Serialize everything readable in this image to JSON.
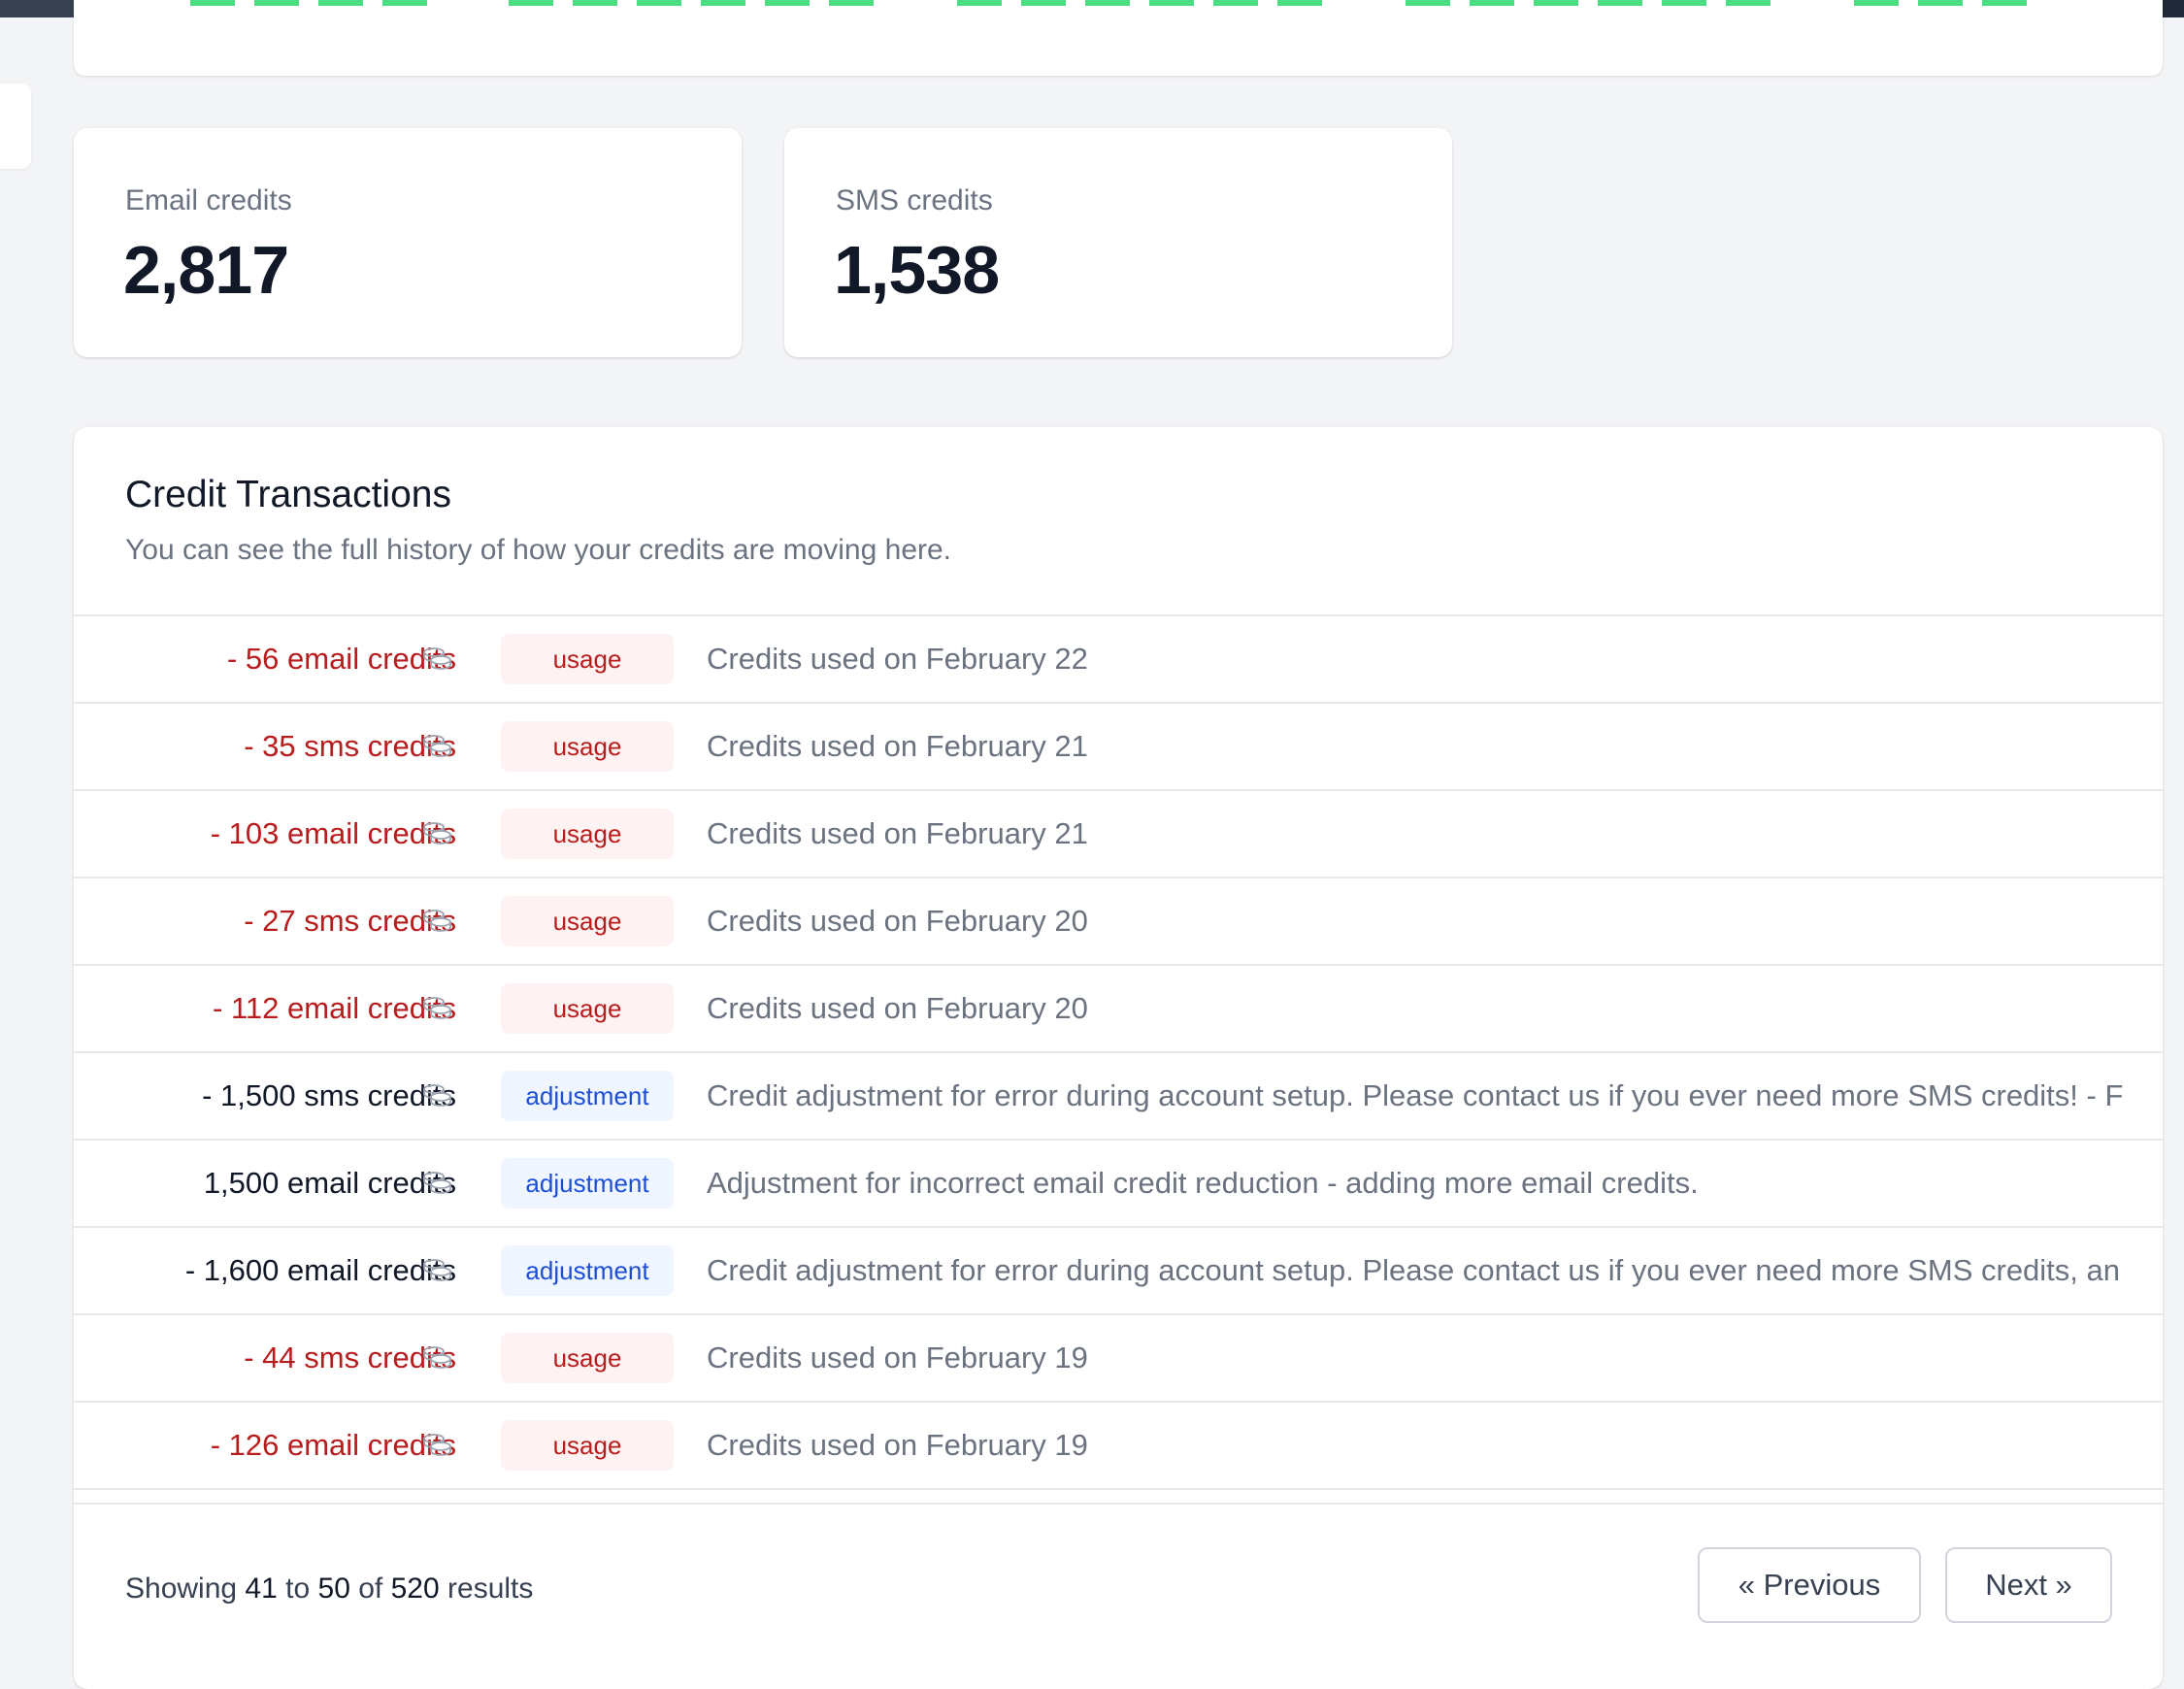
{
  "stats": [
    {
      "label": "Email credits",
      "value": "2,817"
    },
    {
      "label": "SMS credits",
      "value": "1,538"
    }
  ],
  "transactions": {
    "title": "Credit Transactions",
    "subtitle": "You can see the full history of how your credits are moving here.",
    "rows": [
      {
        "amount": "- 56 email credits",
        "kind": "neg",
        "type": "usage",
        "description": "Credits used on February 22"
      },
      {
        "amount": "- 35 sms credits",
        "kind": "neg",
        "type": "usage",
        "description": "Credits used on February 21"
      },
      {
        "amount": "- 103 email credits",
        "kind": "neg",
        "type": "usage",
        "description": "Credits used on February 21"
      },
      {
        "amount": "- 27 sms credits",
        "kind": "neg",
        "type": "usage",
        "description": "Credits used on February 20"
      },
      {
        "amount": "- 112 email credits",
        "kind": "neg",
        "type": "usage",
        "description": "Credits used on February 20"
      },
      {
        "amount": "- 1,500 sms credits",
        "kind": "pos",
        "type": "adjustment",
        "description": "Credit adjustment for error during account setup. Please contact us if you ever need more SMS credits! - F"
      },
      {
        "amount": "1,500 email credits",
        "kind": "pos",
        "type": "adjustment",
        "description": "Adjustment for incorrect email credit reduction - adding more email credits."
      },
      {
        "amount": "- 1,600 email credits",
        "kind": "pos",
        "type": "adjustment",
        "description": "Credit adjustment for error during account setup. Please contact us if you ever need more SMS credits, an"
      },
      {
        "amount": "- 44 sms credits",
        "kind": "neg",
        "type": "usage",
        "description": "Credits used on February 19"
      },
      {
        "amount": "- 126 email credits",
        "kind": "neg",
        "type": "usage",
        "description": "Credits used on February 19"
      }
    ]
  },
  "pagination": {
    "showing_prefix": "Showing",
    "from": "41",
    "to_word": "to",
    "to": "50",
    "of_word": "of",
    "total": "520",
    "suffix": "results",
    "previous_label": "« Previous",
    "next_label": "Next »"
  },
  "colors": {
    "usage_text": "#b91c1c",
    "usage_bg": "#fef2f2",
    "adjustment_text": "#1d4ed8",
    "adjustment_bg": "#eff6ff",
    "activity_bar": "#4ade80"
  },
  "icons": {
    "row_icon": "coins-icon"
  }
}
